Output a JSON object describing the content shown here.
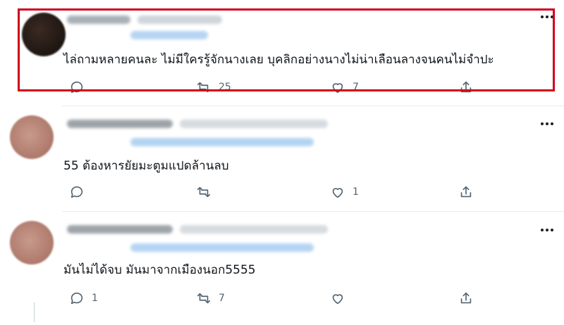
{
  "colors": {
    "highlight": "#d0021b",
    "icon": "#536471",
    "text": "#0f1419"
  },
  "tweets": [
    {
      "text": "ไล่ถามหลายคนละ ไม่มีใครรู้จักนางเลย บุคลิกอย่างนางไม่น่าเลือนลางจนคนไม่จำปะ",
      "reply_count": "",
      "retweet_count": "25",
      "like_count": "7",
      "highlighted": true
    },
    {
      "text": "55 ต้องหารยัยมะตูมแปดล้านลบ",
      "reply_count": "",
      "retweet_count": "",
      "like_count": "1",
      "highlighted": false
    },
    {
      "text": "มันไม่ได้จบ มันมาจากเมืองนอก5555",
      "reply_count": "1",
      "retweet_count": "7",
      "like_count": "",
      "highlighted": false
    }
  ],
  "icons": [
    "more-icon",
    "reply-icon",
    "retweet-icon",
    "like-icon",
    "share-icon"
  ]
}
